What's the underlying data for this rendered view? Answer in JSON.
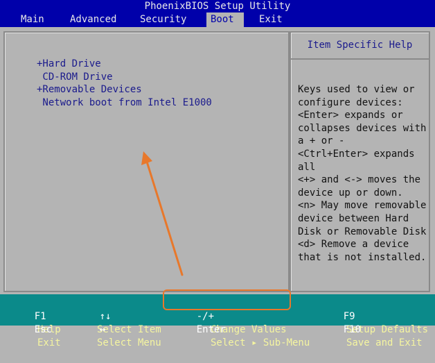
{
  "app": {
    "title": "PhoenixBIOS Setup Utility"
  },
  "menu": {
    "items": [
      {
        "label": "Main"
      },
      {
        "label": "Advanced"
      },
      {
        "label": "Security"
      },
      {
        "label": "Boot"
      },
      {
        "label": "Exit"
      }
    ],
    "active": "Boot"
  },
  "boot": {
    "items": [
      {
        "label": "+Hard Drive"
      },
      {
        "label": " CD-ROM Drive"
      },
      {
        "label": "+Removable Devices"
      },
      {
        "label": " Network boot from Intel E1000"
      }
    ]
  },
  "help": {
    "title": "Item Specific Help",
    "lines": [
      "Keys used to view or",
      "configure devices:",
      "<Enter> expands or",
      "collapses devices with",
      "a + or -",
      "<Ctrl+Enter> expands",
      "all",
      "<+> and <-> moves the",
      "device up or down.",
      "<n> May move removable",
      "device between Hard",
      "Disk or Removable Disk",
      "<d> Remove a device",
      "that is not installed."
    ]
  },
  "footer": {
    "row1": [
      {
        "key": "F1",
        "desc": "Help"
      },
      {
        "key": "↑↓",
        "desc": "Select Item"
      },
      {
        "key": "-/+",
        "desc": "Change Values"
      },
      {
        "key": "F9",
        "desc": "Setup Defaults"
      }
    ],
    "row2": [
      {
        "key": "Esc",
        "desc": "Exit"
      },
      {
        "key": "↔",
        "desc": "Select Menu"
      },
      {
        "key": "Enter",
        "desc": "Select ▸ Sub-Menu"
      },
      {
        "key": "F10",
        "desc": "Save and Exit"
      }
    ]
  },
  "colors": {
    "bios_blue": "#0000aa",
    "panel_gray": "#b4b4b4",
    "footer_teal": "#0b8a8a",
    "annotation_orange": "#e8782b"
  }
}
